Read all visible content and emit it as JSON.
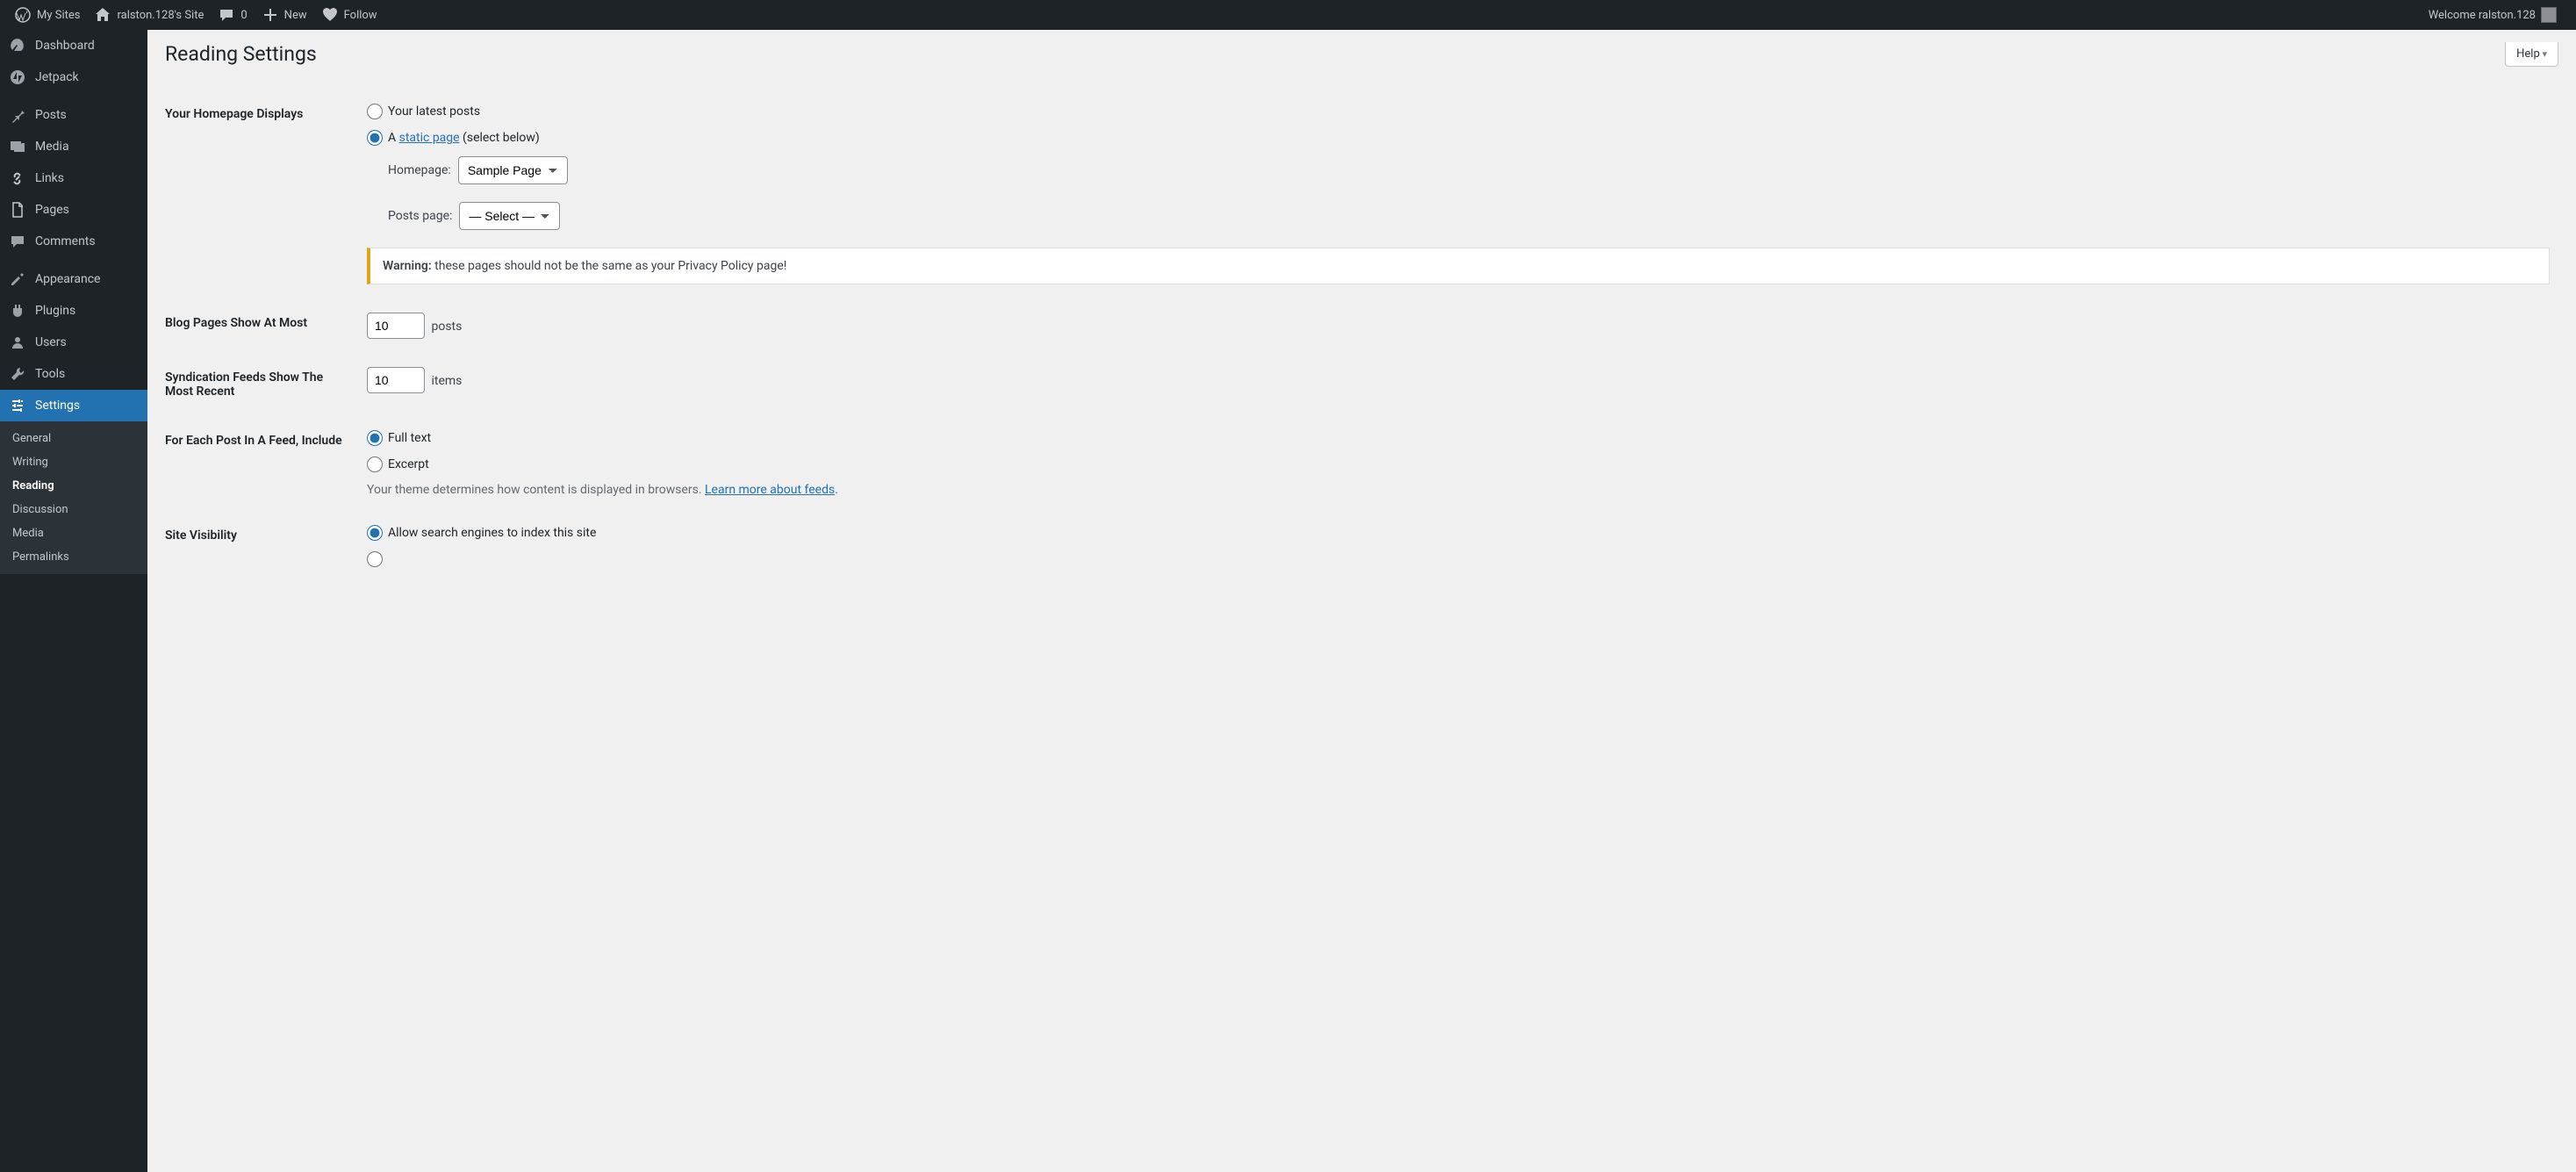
{
  "adminbar": {
    "my_sites": "My Sites",
    "site_name": "ralston.128's Site",
    "comments": "0",
    "new": "New",
    "follow": "Follow",
    "welcome": "Welcome ralston.128"
  },
  "menu": {
    "dashboard": "Dashboard",
    "jetpack": "Jetpack",
    "posts": "Posts",
    "media": "Media",
    "links": "Links",
    "pages": "Pages",
    "comments": "Comments",
    "appearance": "Appearance",
    "plugins": "Plugins",
    "users": "Users",
    "tools": "Tools",
    "settings": "Settings"
  },
  "submenu": {
    "general": "General",
    "writing": "Writing",
    "reading": "Reading",
    "discussion": "Discussion",
    "media": "Media",
    "permalinks": "Permalinks"
  },
  "header": {
    "title": "Reading Settings",
    "help": "Help"
  },
  "homepage": {
    "label": "Your Homepage Displays",
    "opt_latest": "Your latest posts",
    "opt_static_prefix": "A ",
    "opt_static_link": "static page",
    "opt_static_suffix": " (select below)",
    "homepage_label": "Homepage:",
    "homepage_value": "Sample Page",
    "posts_page_label": "Posts page:",
    "posts_page_value": "— Select —",
    "warning_strong": "Warning:",
    "warning_text": " these pages should not be the same as your Privacy Policy page!"
  },
  "blog_pages": {
    "label": "Blog Pages Show At Most",
    "value": "10",
    "suffix": "posts"
  },
  "feeds": {
    "label": "Syndication Feeds Show The Most Recent",
    "value": "10",
    "suffix": "items"
  },
  "feed_include": {
    "label": "For Each Post In A Feed, Include",
    "opt_full": "Full text",
    "opt_excerpt": "Excerpt",
    "desc_prefix": "Your theme determines how content is displayed in browsers. ",
    "desc_link": "Learn more about feeds",
    "desc_suffix": "."
  },
  "visibility": {
    "label": "Site Visibility",
    "opt_allow": "Allow search engines to index this site"
  }
}
